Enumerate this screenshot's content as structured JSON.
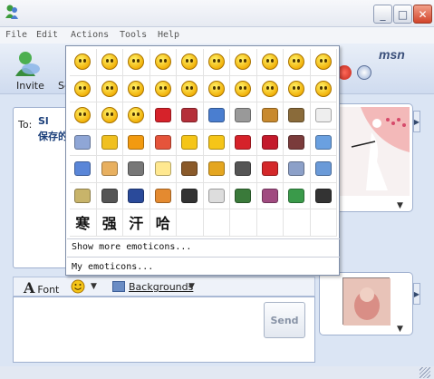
{
  "window": {
    "minimize": "_",
    "maximize": "□",
    "close": "✕"
  },
  "menu": {
    "items": [
      "File",
      "Edit",
      "Actions",
      "Tools",
      "Help"
    ]
  },
  "toolbar": {
    "invite_label": "Invite",
    "second_label_partial": "Se",
    "logo": "msn"
  },
  "conversation": {
    "to_label": "To:",
    "contact_name": "Sl",
    "contact_message": "保存的"
  },
  "compose": {
    "font_label": "Font",
    "backgrounds_label": "Backgrounds",
    "send_label": "Send"
  },
  "emoticon_popup": {
    "rows": [
      [
        "smile",
        "grin",
        "wink",
        "surprised",
        "tongue",
        "sunglasses",
        "angry",
        "confused",
        "embarrassed",
        "sad"
      ],
      [
        "crying",
        "disappointed",
        "sick",
        "nerd",
        "thinking",
        "party",
        "sleepy",
        "secret",
        "sarcastic",
        "eye-roll"
      ],
      [
        "smoke",
        "baring-teeth",
        "dont-tell",
        "red-heart",
        "broken-heart",
        "people",
        "cat",
        "dog",
        "snail",
        "sheep"
      ],
      [
        "moon",
        "star",
        "sun",
        "rainbow",
        "hug-left",
        "hug-right",
        "kiss",
        "rose",
        "wilted-rose",
        "clock"
      ],
      [
        "gift",
        "cake",
        "camera",
        "light-bulb",
        "coffee",
        "phone",
        "mobile-phone",
        "car",
        "airplane",
        "computer"
      ],
      [
        "money",
        "film",
        "music",
        "pizza",
        "soccer-ball",
        "email",
        "boy",
        "girl",
        "island",
        "umbrella"
      ],
      [
        "寒",
        "强",
        "汗",
        "哈"
      ]
    ],
    "links": [
      "Show more emoticons...",
      "My emoticons..."
    ]
  },
  "colors": {
    "accent": "#1b3f7a",
    "panel_border": "#9fb0cf",
    "popup_border": "#7f8ea9"
  }
}
